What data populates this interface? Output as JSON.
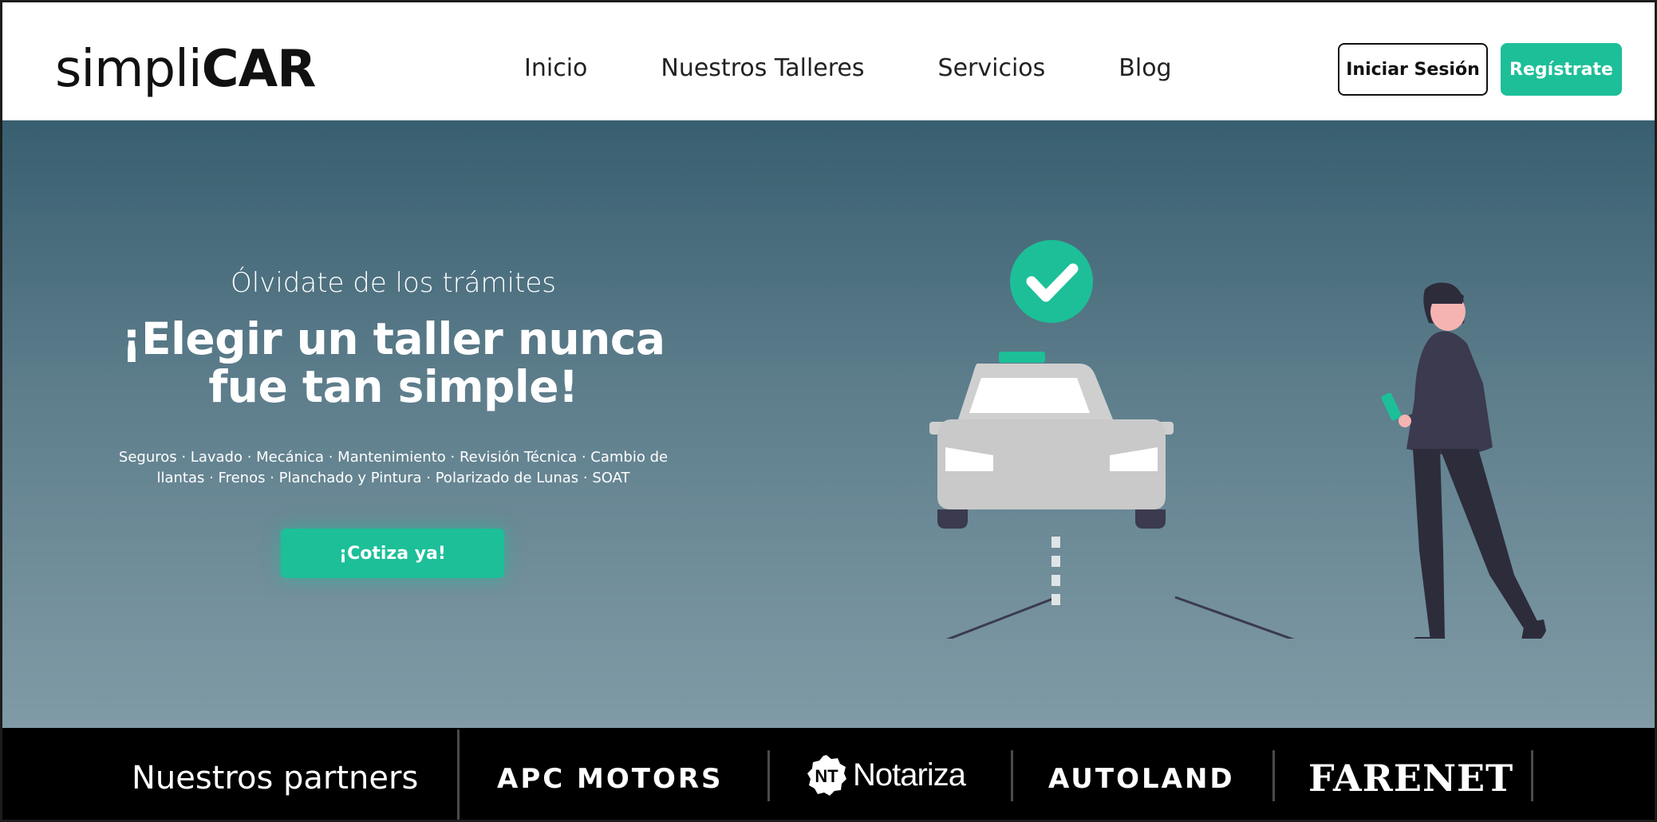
{
  "brand": {
    "logo_light": "simpli",
    "logo_bold": "CAR"
  },
  "nav": {
    "links": [
      "Inicio",
      "Nuestros Talleres",
      "Servicios",
      "Blog"
    ],
    "login_label": "Iniciar Sesión",
    "register_label": "Regístrate"
  },
  "hero": {
    "kicker": "Ólvidate de los trámites",
    "title": "¡Elegir un taller nunca fue tan simple!",
    "services": "Seguros · Lavado · Mecánica · Mantenimiento · Revisión Técnica · Cambio de llantas · Frenos · Planchado y Pintura  · Polarizado de Lunas  · SOAT",
    "cta_label": "¡Cotiza ya!"
  },
  "partners": {
    "title": "Nuestros partners",
    "items": [
      {
        "name": "APC  MOTORS"
      },
      {
        "name": "Notariza",
        "badge": "NT"
      },
      {
        "name": "AUTOLAND"
      },
      {
        "name": "FARENET"
      }
    ]
  },
  "colors": {
    "accent": "#1dbf98",
    "hero_top": "#385f70",
    "hero_bottom": "#809ba6",
    "partners_bg": "#000000"
  },
  "icons": [
    "check-circle-icon",
    "car-illustration",
    "woman-with-phone-illustration"
  ]
}
